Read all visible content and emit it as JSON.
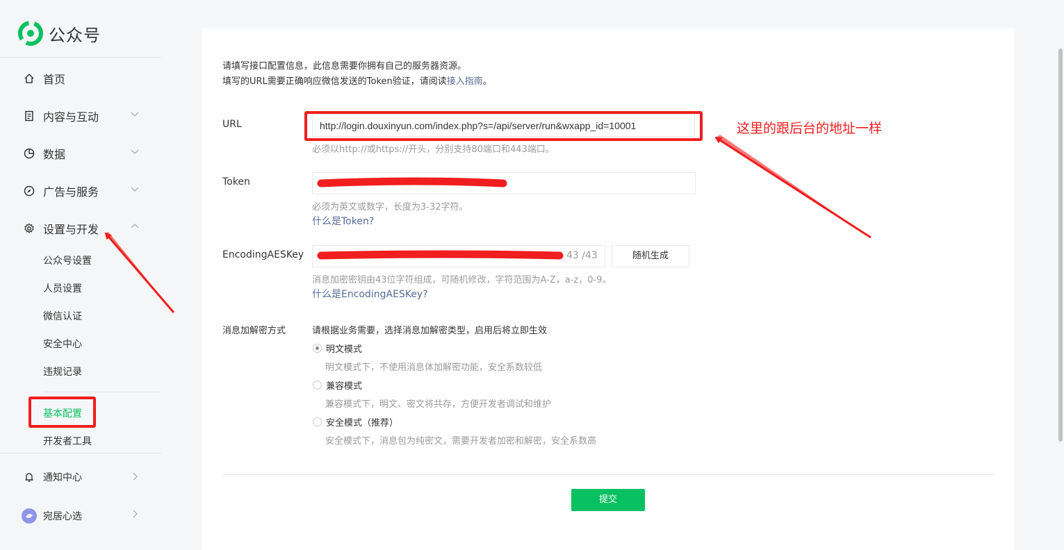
{
  "app": {
    "logo_text": "公众号"
  },
  "sidebar": {
    "items": [
      {
        "label": "首页",
        "icon": "home-icon"
      },
      {
        "label": "内容与互动",
        "icon": "document-icon"
      },
      {
        "label": "数据",
        "icon": "pie-chart-icon"
      },
      {
        "label": "广告与服务",
        "icon": "compass-icon"
      },
      {
        "label": "设置与开发",
        "icon": "gear-icon",
        "expanded": true
      }
    ],
    "settings_sub": [
      "公众号设置",
      "人员设置",
      "微信认证",
      "安全中心",
      "违规记录"
    ],
    "dev_sub": [
      "基本配置",
      "开发者工具"
    ],
    "bottom": [
      {
        "label": "通知中心",
        "icon": "bell-icon"
      },
      {
        "label": "宛居心选",
        "icon": "avatar-icon"
      }
    ]
  },
  "intro": {
    "line1": "请填写接口配置信息，此信息需要你拥有自己的服务器资源。",
    "line2_prefix": "填写的URL需要正确响应微信发送的Token验证，请阅读",
    "line2_link": "接入指南",
    "line2_suffix": "。"
  },
  "form": {
    "url": {
      "label": "URL",
      "value": "http://login.douxinyun.com/index.php?s=/api/server/run&wxapp_id=10001",
      "hint": "必须以http://或https://开头，分别支持80端口和443端口。"
    },
    "token": {
      "label": "Token",
      "hint": "必须为英文或数字，长度为3-32字符。",
      "help_link": "什么是Token?"
    },
    "aes": {
      "label": "EncodingAESKey",
      "counter": "43 /43",
      "generate_label": "随机生成",
      "hint": "消息加密密钥由43位字符组成，可随机修改，字符范围为A-Z，a-z，0-9。",
      "help_link": "什么是EncodingAESKey?"
    },
    "encryption": {
      "label": "消息加解密方式",
      "description": "请根据业务需要，选择消息加解密类型，启用后将立即生效",
      "options": [
        {
          "label": "明文模式",
          "hint": "明文模式下，不使用消息体加解密功能，安全系数较低",
          "selected": true
        },
        {
          "label": "兼容模式",
          "hint": "兼容模式下，明文、密文将共存，方便开发者调试和维护",
          "selected": false
        },
        {
          "label": "安全模式（推荐）",
          "hint": "安全模式下，消息包为纯密文，需要开发者加密和解密，安全系数高",
          "selected": false
        }
      ]
    },
    "submit_label": "提交"
  },
  "annotation": {
    "text": "这里的跟后台的地址一样",
    "color": "#f01e1e"
  },
  "colors": {
    "accent": "#07c160",
    "link": "#576b95",
    "annotation": "#f01e1e"
  }
}
